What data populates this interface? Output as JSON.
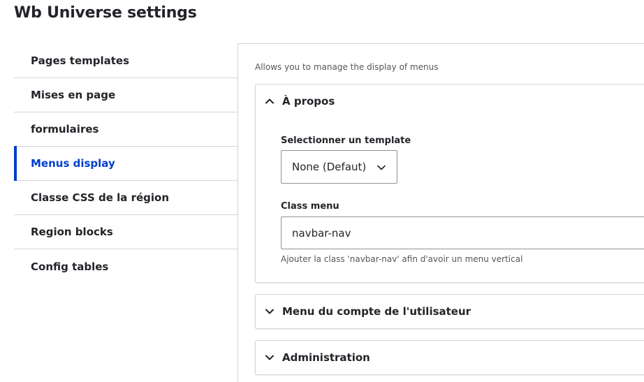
{
  "page": {
    "title": "Wb Universe settings"
  },
  "sidebar": {
    "items": [
      {
        "label": "Pages templates",
        "active": false
      },
      {
        "label": "Mises en page",
        "active": false
      },
      {
        "label": "formulaires",
        "active": false
      },
      {
        "label": "Menus display",
        "active": true
      },
      {
        "label": "Classe CSS de la région",
        "active": false
      },
      {
        "label": "Region blocks",
        "active": false
      },
      {
        "label": "Config tables",
        "active": false
      }
    ]
  },
  "main": {
    "description": "Allows you to manage the display of menus",
    "sections": [
      {
        "title": "À propos",
        "expanded": true,
        "template_label": "Selectionner un template",
        "template_value": "None (Defaut)",
        "class_label": "Class menu",
        "class_value": "navbar-nav",
        "class_help": "Ajouter la class 'navbar-nav' afin d'avoir un menu vertical"
      },
      {
        "title": "Menu du compte de l'utilisateur",
        "expanded": false
      },
      {
        "title": "Administration",
        "expanded": false
      }
    ]
  },
  "colors": {
    "accent": "#003ecc",
    "border": "#d3d4d9",
    "text": "#232429",
    "muted": "#55565b"
  },
  "icons": {
    "expanded": "chevron-up-icon",
    "collapsed": "chevron-down-icon",
    "select": "chevron-down-icon"
  }
}
